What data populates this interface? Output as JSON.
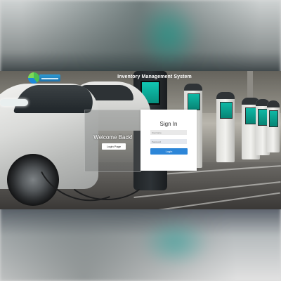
{
  "header": {
    "title": "Inventory Management System",
    "logo_icon": "company-logo"
  },
  "welcome": {
    "title": "Welcome Back!",
    "login_page_label": "Login Page"
  },
  "signin": {
    "title": "Sign In",
    "username_placeholder": "Username",
    "password_placeholder": "Password",
    "login_label": "Login"
  },
  "colors": {
    "primary_button": "#2d86d8",
    "charger_screen": "#0fb8a5"
  }
}
